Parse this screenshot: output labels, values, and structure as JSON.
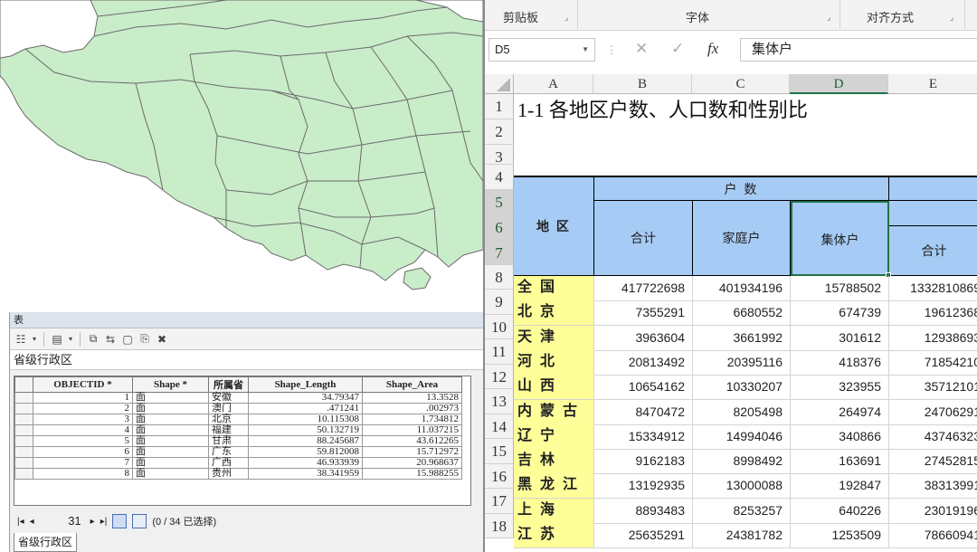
{
  "gis": {
    "window_title": "表",
    "layer_name": "省级行政区",
    "columns": [
      "OBJECTID *",
      "Shape *",
      "所属省",
      "Shape_Length",
      "Shape_Area"
    ],
    "rows": [
      [
        "1",
        "面",
        "安徽",
        "34.79347",
        "13.3528"
      ],
      [
        "2",
        "面",
        "澳门",
        ".471241",
        ".002973"
      ],
      [
        "3",
        "面",
        "北京",
        "10.115308",
        "1.734812"
      ],
      [
        "4",
        "面",
        "福建",
        "50.132719",
        "11.037215"
      ],
      [
        "5",
        "面",
        "甘肃",
        "88.245687",
        "43.612265"
      ],
      [
        "6",
        "面",
        "广东",
        "59.812008",
        "15.712972"
      ],
      [
        "7",
        "面",
        "广西",
        "46.933939",
        "20.968637"
      ],
      [
        "8",
        "面",
        "贵州",
        "38.341959",
        "15.988255"
      ]
    ],
    "nav": {
      "record": "31",
      "selection": "(0 / 34 已选择)"
    },
    "bottom_tab": "省级行政区",
    "map_fill": "#c9ecc9"
  },
  "excel": {
    "ribbon": {
      "clipboard": "剪贴板",
      "font": "字体",
      "alignment": "对齐方式"
    },
    "name_box": "D5",
    "formula": "集体户",
    "fx": "fx",
    "columns": [
      "A",
      "B",
      "C",
      "D",
      "E"
    ],
    "row_numbers": [
      "1",
      "2",
      "3",
      "4",
      "5",
      "6",
      "7",
      "8",
      "9",
      "10",
      "11",
      "12",
      "13",
      "14",
      "15",
      "16",
      "17",
      "18"
    ],
    "title": "1-1  各地区户数、人口数和性别比",
    "header": {
      "region": "地    区",
      "households": "户       数",
      "total": "合计",
      "family": "家庭户",
      "collective": "集体户",
      "pop_total": "合计"
    },
    "data": [
      {
        "region": "全国",
        "total": "417722698",
        "family": "401934196",
        "collective": "15788502",
        "e": "1332810869"
      },
      {
        "region": "北京",
        "total": "7355291",
        "family": "6680552",
        "collective": "674739",
        "e": "19612368"
      },
      {
        "region": "天津",
        "total": "3963604",
        "family": "3661992",
        "collective": "301612",
        "e": "12938693"
      },
      {
        "region": "河北",
        "total": "20813492",
        "family": "20395116",
        "collective": "418376",
        "e": "71854210"
      },
      {
        "region": "山西",
        "total": "10654162",
        "family": "10330207",
        "collective": "323955",
        "e": "35712101"
      },
      {
        "region": "内蒙古",
        "total": "8470472",
        "family": "8205498",
        "collective": "264974",
        "e": "24706291"
      },
      {
        "region": "辽宁",
        "total": "15334912",
        "family": "14994046",
        "collective": "340866",
        "e": "43746323"
      },
      {
        "region": "吉林",
        "total": "9162183",
        "family": "8998492",
        "collective": "163691",
        "e": "27452815"
      },
      {
        "region": "黑龙江",
        "total": "13192935",
        "family": "13000088",
        "collective": "192847",
        "e": "38313991"
      },
      {
        "region": "上海",
        "total": "8893483",
        "family": "8253257",
        "collective": "640226",
        "e": "23019196"
      },
      {
        "region": "江苏",
        "total": "25635291",
        "family": "24381782",
        "collective": "1253509",
        "e": "78660941"
      }
    ]
  }
}
